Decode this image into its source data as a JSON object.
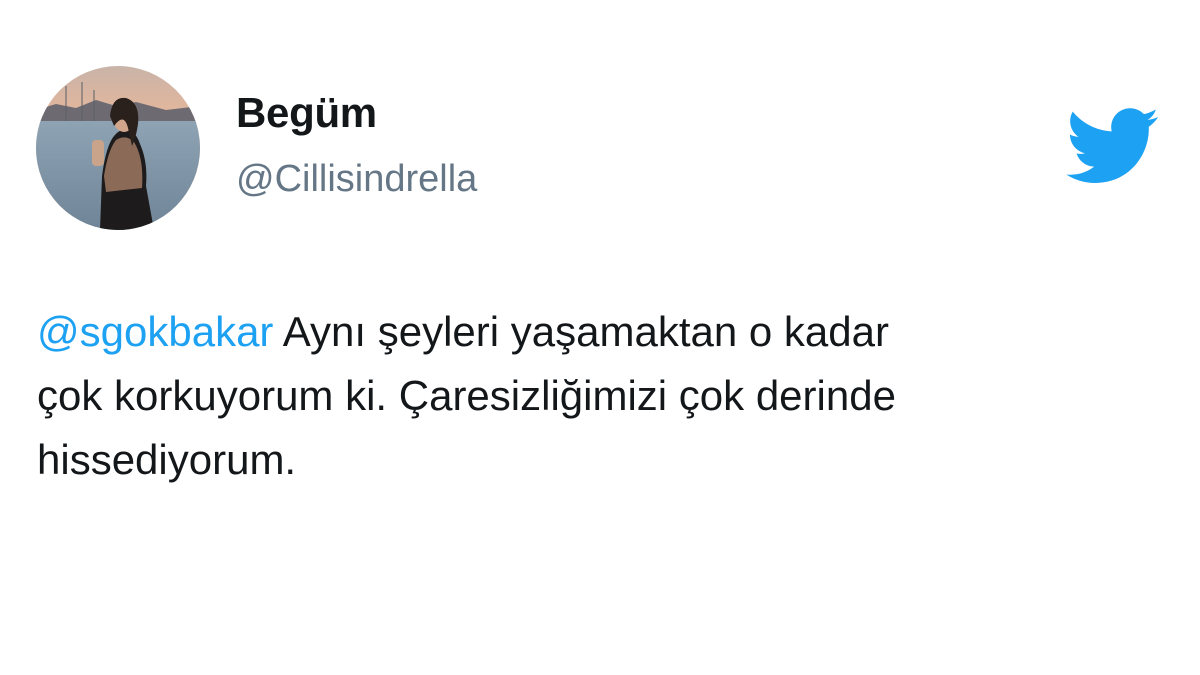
{
  "user": {
    "display_name": "Begüm",
    "handle": "@Cillisindrella",
    "avatar_icon": "user-photo-avatar"
  },
  "tweet": {
    "mention": "@sgokbakar",
    "line1": " Aynı şeyleri yaşamaktan o kadar",
    "line2": "çok korkuyorum ki. Çaresizliğimizi çok derinde",
    "line3": "hissediyorum."
  },
  "brand": {
    "logo_icon": "twitter-bird-icon",
    "accent_color": "#1da1f2",
    "handle_color": "#657786",
    "text_color": "#14171a"
  }
}
